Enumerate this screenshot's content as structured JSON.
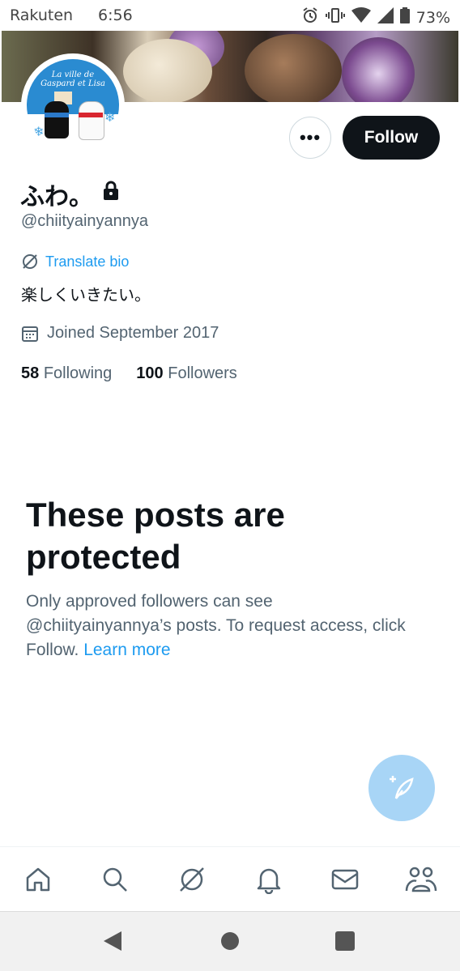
{
  "status_bar": {
    "carrier": "Rakuten",
    "time": "6:56",
    "battery": "73%",
    "icons": [
      "alarm-icon",
      "vibrate-icon",
      "wifi-icon",
      "signal-icon",
      "battery-icon"
    ]
  },
  "profile": {
    "banner_icon": "banner-image",
    "avatar_text_line1": "La ville de",
    "avatar_text_line2": "Gaspard et Lisa",
    "display_name": "ふわ。",
    "handle": "@chiityainyannya",
    "translate_label": "Translate bio",
    "bio": "楽しくいきたい。",
    "joined": "Joined September 2017",
    "following_count": "58",
    "following_label": "Following",
    "followers_count": "100",
    "followers_label": "Followers"
  },
  "actions": {
    "more_label": "•••",
    "follow_label": "Follow"
  },
  "protected": {
    "title": "These posts are protected",
    "body": "Only approved followers can see @chiityainyannya’s posts. To request access, click Follow.",
    "learn_more": "Learn more"
  },
  "colors": {
    "accent": "#1d9bf0",
    "text_primary": "#0f1419",
    "text_secondary": "#536471",
    "fab": "#a8d5f6"
  },
  "bottom_nav": [
    "home-icon",
    "search-icon",
    "grok-icon",
    "notifications-icon",
    "messages-icon",
    "communities-icon"
  ],
  "system_nav": [
    "back-button",
    "home-button",
    "recents-button"
  ]
}
